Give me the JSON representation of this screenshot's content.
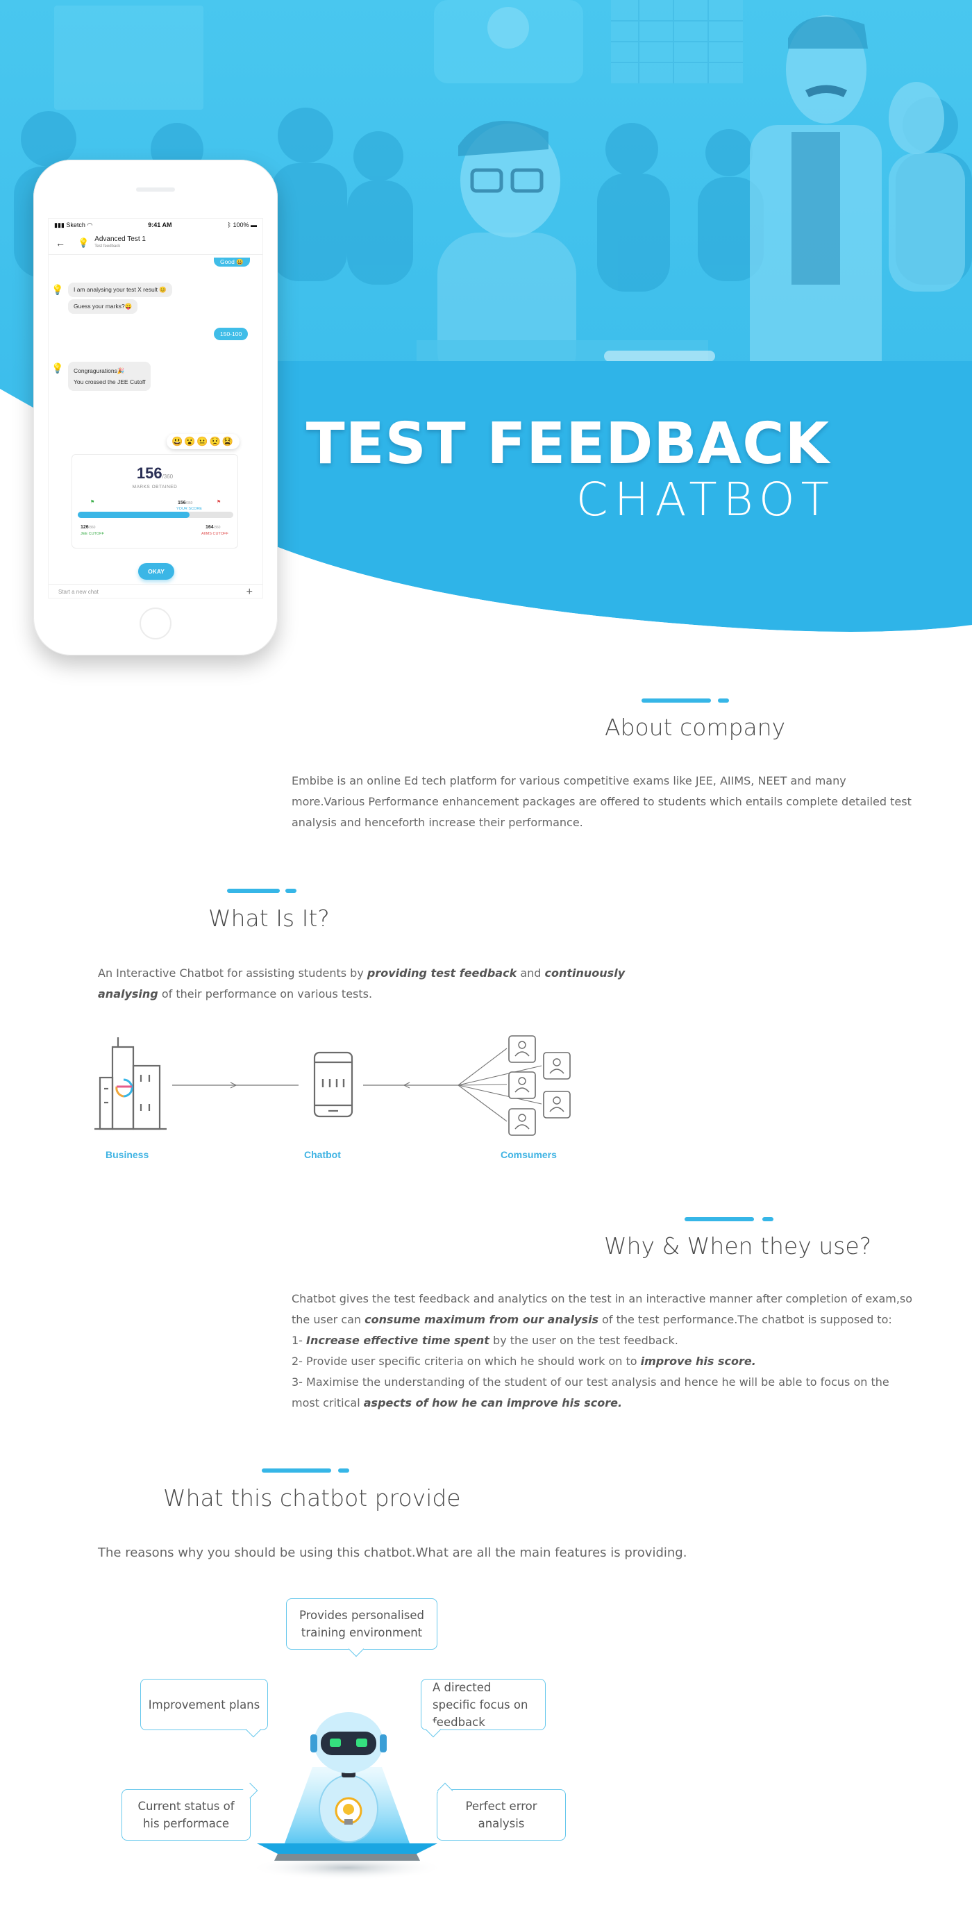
{
  "hero": {
    "title_line1": "TEST FEEDBACK",
    "title_line2": "CHATBOT",
    "colors": {
      "sky": "#3cc0ec",
      "wave": "#2fb4e8",
      "accent": "#36b6e7"
    }
  },
  "phone": {
    "status": {
      "carrier": "Sketch",
      "time": "9:41 AM",
      "battery": "100%"
    },
    "header": {
      "title": "Advanced Test 1",
      "subtitle": "Test feedback"
    },
    "messages": {
      "top_reply": "Good",
      "analysing": "I am analysing your test X result",
      "guess": "Guess your marks?",
      "user_answer": "150-100",
      "congrats": "Congragurations",
      "crossed": "You crossed the JEE Cutoff"
    },
    "emoji_reactions": "😃😮😐😟😫",
    "marks": {
      "score": "156",
      "total": "/360",
      "label": "MARKS OBTAINED",
      "your_score": "156",
      "your_score_suffix": "/360",
      "your_score_label": "YOUR SCORE",
      "jee_cutoff": "126",
      "jee_cutoff_suffix": "/360",
      "jee_cutoff_label": "JEE CUTOFF",
      "aiims_cutoff": "164",
      "aiims_cutoff_suffix": "/360",
      "aiims_cutoff_label": "AIIMS CUTOFF",
      "progress_fraction": 0.72
    },
    "okay_button": "OKAY",
    "input_placeholder": "Start a new chat",
    "plus_icon": "+"
  },
  "about": {
    "heading": "About company",
    "text": "Embibe is an online Ed tech platform for various competitive exams like JEE, AIIMS, NEET and many more.Various Performance enhancement packages are offered to students which  entails complete detailed test analysis and henceforth increase their performance."
  },
  "what": {
    "heading": "What Is It?",
    "text_1": "An Interactive Chatbot for assisting students by ",
    "text_2": "providing test feedback",
    "text_3": " and ",
    "text_4": "continuously analysing",
    "text_5": " of their performance on various tests."
  },
  "flow": {
    "business": "Business",
    "chatbot": "Chatbot",
    "consumers": "Comsumers"
  },
  "why": {
    "heading": "Why & When they use?",
    "l1a": "Chatbot gives the test feedback and analytics on the test in an interactive manner after completion of exam,so the user can ",
    "l1b": "consume maximum from our analysis",
    "l1c": " of the test performance.The chatbot is supposed to:",
    "p1a": "1- ",
    "p1b": "Increase effective time spent",
    "p1c": " by the user on the test feedback.",
    "p2a": "2- Provide user specific criteria on which he should work on to ",
    "p2b": "improve his score.",
    "p3a": "3- Maximise the understanding of the student of our test analysis and hence he will be able to focus on the most critical ",
    "p3b": "aspects of how he can improve his score."
  },
  "provide": {
    "heading": "What this chatbot provide",
    "text": "The reasons why you should be using this chatbot.What are all the main features is providing.",
    "features": {
      "personalised": "Provides personalised training environment",
      "improvement": "Improvement plans",
      "directed": "A directed specific focus on feedback",
      "current": "Current status of his performace",
      "error": "Perfect error analysis"
    }
  }
}
